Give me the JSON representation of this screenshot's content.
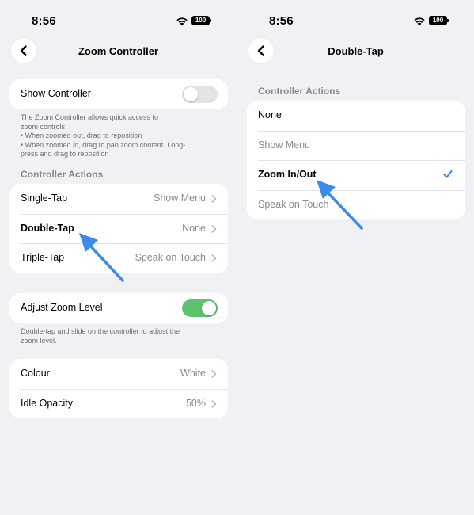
{
  "colors": {
    "accent": "#3a86e8",
    "toggle_on": "#5ec16e",
    "toggle_off": "#e3e3e8",
    "annotation_arrow": "#3b8beb"
  },
  "left": {
    "status": {
      "time": "8:56",
      "battery": "100"
    },
    "nav": {
      "title": "Zoom Controller",
      "back_icon": "chevron-left-icon"
    },
    "show_controller": {
      "label": "Show Controller",
      "on": false
    },
    "show_controller_note": [
      "The Zoom Controller allows quick access to",
      "zoom controls:",
      "• When zoomed out, drag to reposition",
      "• When zoomed in, drag to pan zoom content. Long-",
      "press and drag to reposition"
    ],
    "section": "Controller Actions",
    "actions": [
      {
        "label": "Single-Tap",
        "value": "Show Menu"
      },
      {
        "label": "Double-Tap",
        "value": "None"
      },
      {
        "label": "Triple-Tap",
        "value": "Speak on Touch"
      }
    ],
    "adjust_zoom": {
      "label": "Adjust Zoom Level",
      "on": true
    },
    "adjust_zoom_note": [
      "Double-tap and slide on the controller to adjust the",
      "zoom level."
    ],
    "appearance": [
      {
        "label": "Colour",
        "value": "White"
      },
      {
        "label": "Idle Opacity",
        "value": "50%"
      }
    ]
  },
  "right": {
    "status": {
      "time": "8:56",
      "battery": "100"
    },
    "nav": {
      "title": "Double-Tap",
      "back_icon": "chevron-left-icon"
    },
    "section": "Controller Actions",
    "options": [
      {
        "label": "None",
        "selected": false
      },
      {
        "label": "Show Menu",
        "selected": false
      },
      {
        "label": "Zoom In/Out",
        "selected": true
      },
      {
        "label": "Speak on Touch",
        "selected": false
      }
    ]
  }
}
